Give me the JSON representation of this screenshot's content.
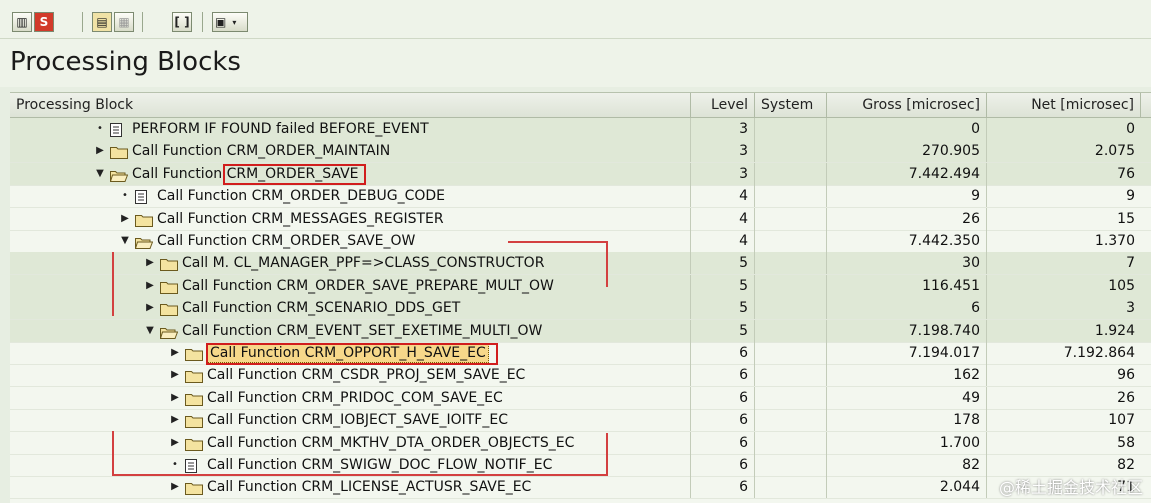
{
  "window": {
    "title": "Processing Blocks"
  },
  "toolbar": {
    "buttons": [
      {
        "name": "binoculars-find-button",
        "glyph": "🔍"
      },
      {
        "name": "stop-button",
        "glyph": "S"
      },
      {
        "name": "hierarchy-button",
        "glyph": "▤"
      },
      {
        "name": "grid-button",
        "glyph": "▦"
      },
      {
        "name": "brackets-button",
        "glyph": "[ ]"
      },
      {
        "name": "export-button",
        "glyph": "▣"
      }
    ]
  },
  "table": {
    "columns": {
      "block": "Processing Block",
      "level": "Level",
      "system": "System",
      "gross": "Gross [microsec]",
      "net": "Net [microsec]"
    },
    "rows": [
      {
        "indent": 0,
        "expander": "dot",
        "icon": "doc",
        "label": "PERFORM IF FOUND failed BEFORE_EVENT",
        "level": "3",
        "system": "",
        "gross": "0",
        "net": "0",
        "shade": true
      },
      {
        "indent": 0,
        "expander": "right",
        "icon": "folder",
        "label": "Call Function CRM_ORDER_MAINTAIN",
        "level": "3",
        "system": "",
        "gross": "270.905",
        "net": "2.075",
        "shade": true
      },
      {
        "indent": 0,
        "expander": "down",
        "icon": "folder-open",
        "label": "Call Function CRM_ORDER_SAVE",
        "level": "3",
        "system": "",
        "gross": "7.442.494",
        "net": "76",
        "shade": true
      },
      {
        "indent": 1,
        "expander": "dot",
        "icon": "doc",
        "label": "Call Function CRM_ORDER_DEBUG_CODE",
        "level": "4",
        "system": "",
        "gross": "9",
        "net": "9",
        "shade": false
      },
      {
        "indent": 1,
        "expander": "right",
        "icon": "folder",
        "label": "Call Function CRM_MESSAGES_REGISTER",
        "level": "4",
        "system": "",
        "gross": "26",
        "net": "15",
        "shade": false
      },
      {
        "indent": 1,
        "expander": "down",
        "icon": "folder-open",
        "label": "Call Function CRM_ORDER_SAVE_OW",
        "level": "4",
        "system": "",
        "gross": "7.442.350",
        "net": "1.370",
        "shade": false
      },
      {
        "indent": 2,
        "expander": "right",
        "icon": "folder",
        "label": "Call M. CL_MANAGER_PPF=>CLASS_CONSTRUCTOR",
        "level": "5",
        "system": "",
        "gross": "30",
        "net": "7",
        "shade": true
      },
      {
        "indent": 2,
        "expander": "right",
        "icon": "folder",
        "label": "Call Function CRM_ORDER_SAVE_PREPARE_MULT_OW",
        "level": "5",
        "system": "",
        "gross": "116.451",
        "net": "105",
        "shade": true
      },
      {
        "indent": 2,
        "expander": "right",
        "icon": "folder",
        "label": "Call Function CRM_SCENARIO_DDS_GET",
        "level": "5",
        "system": "",
        "gross": "6",
        "net": "3",
        "shade": true
      },
      {
        "indent": 2,
        "expander": "down",
        "icon": "folder-open",
        "label": "Call Function CRM_EVENT_SET_EXETIME_MULTI_OW",
        "level": "5",
        "system": "",
        "gross": "7.198.740",
        "net": "1.924",
        "shade": true
      },
      {
        "indent": 3,
        "expander": "right",
        "icon": "folder",
        "label": "Call Function CRM_OPPORT_H_SAVE_EC",
        "level": "6",
        "system": "",
        "gross": "7.194.017",
        "net": "7.192.864",
        "shade": false,
        "selected": true
      },
      {
        "indent": 3,
        "expander": "right",
        "icon": "folder",
        "label": "Call Function CRM_CSDR_PROJ_SEM_SAVE_EC",
        "level": "6",
        "system": "",
        "gross": "162",
        "net": "96",
        "shade": false
      },
      {
        "indent": 3,
        "expander": "right",
        "icon": "folder",
        "label": "Call Function CRM_PRIDOC_COM_SAVE_EC",
        "level": "6",
        "system": "",
        "gross": "49",
        "net": "26",
        "shade": false
      },
      {
        "indent": 3,
        "expander": "right",
        "icon": "folder",
        "label": "Call Function CRM_IOBJECT_SAVE_IOITF_EC",
        "level": "6",
        "system": "",
        "gross": "178",
        "net": "107",
        "shade": false
      },
      {
        "indent": 3,
        "expander": "right",
        "icon": "folder",
        "label": "Call Function CRM_MKTHV_DTA_ORDER_OBJECTS_EC",
        "level": "6",
        "system": "",
        "gross": "1.700",
        "net": "58",
        "shade": false
      },
      {
        "indent": 3,
        "expander": "dot",
        "icon": "doc",
        "label": "Call Function CRM_SWIGW_DOC_FLOW_NOTIF_EC",
        "level": "6",
        "system": "",
        "gross": "82",
        "net": "82",
        "shade": false
      },
      {
        "indent": 3,
        "expander": "right",
        "icon": "folder",
        "label": "Call Function CRM_LICENSE_ACTUSR_SAVE_EC",
        "level": "6",
        "system": "",
        "gross": "2.044",
        "net": "71",
        "shade": false
      }
    ]
  },
  "watermark": "@稀土掘金技术社区"
}
